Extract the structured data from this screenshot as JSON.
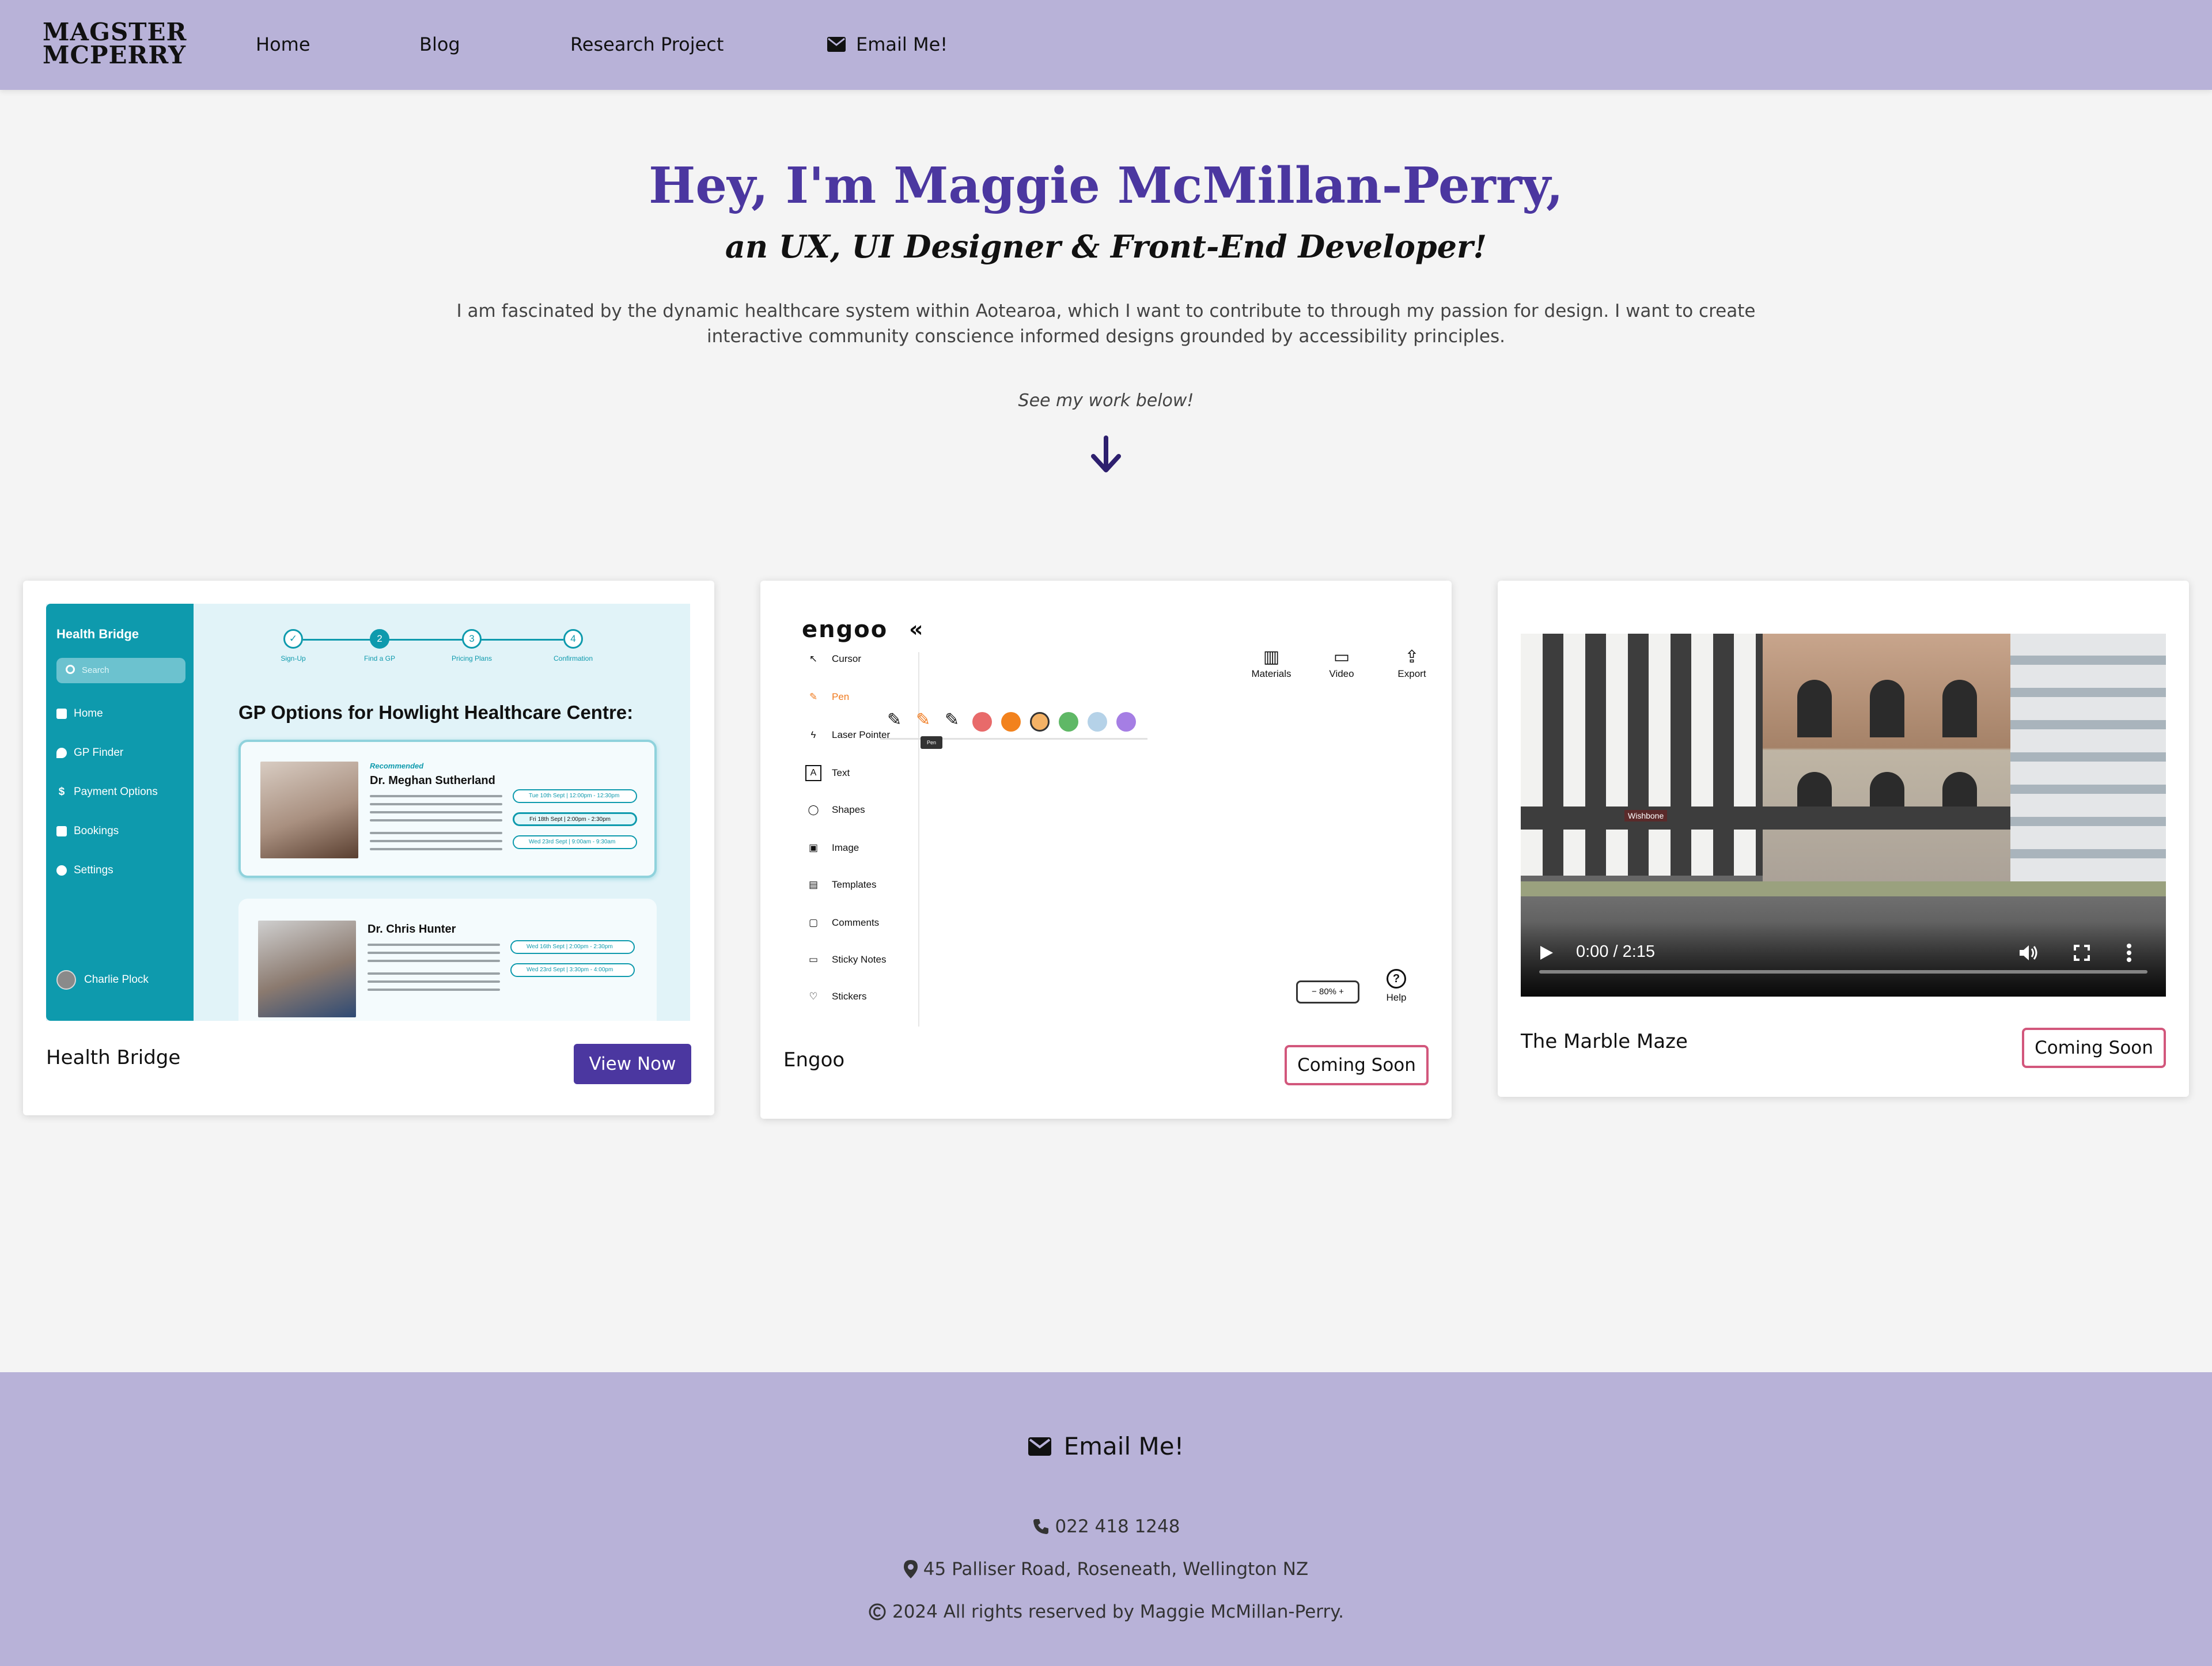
{
  "nav": {
    "logo": "MAGSTER MCPERRY",
    "links": [
      "Home",
      "Blog",
      "Research Project"
    ],
    "email_label": "Email Me!"
  },
  "hero": {
    "title": "Hey, I'm Maggie McMillan-Perry,",
    "subtitle": "an UX, UI Designer & Front-End Developer!",
    "description": "I am fascinated by the dynamic healthcare system within Aotearoa, which I want to contribute to through my passion for design. I want to create interactive community conscience informed designs grounded by accessibility principles.",
    "see_work": "See my work below!"
  },
  "projects": [
    {
      "title": "Health Bridge",
      "button": "View Now",
      "preview": {
        "brand": "Health Bridge",
        "search_placeholder": "Search",
        "menu": [
          "Home",
          "GP Finder",
          "Payment Options",
          "Bookings",
          "Settings"
        ],
        "user": "Charlie Plock",
        "steps": [
          {
            "num": "✓",
            "label": "Sign-Up"
          },
          {
            "num": "2",
            "label": "Find a GP"
          },
          {
            "num": "3",
            "label": "Pricing Plans"
          },
          {
            "num": "4",
            "label": "Confirmation"
          }
        ],
        "heading": "GP Options for Howlight Healthcare Centre:",
        "doctors": [
          {
            "tag": "Recommended",
            "name": "Dr. Meghan Sutherland",
            "slots": [
              "Tue 10th Sept | 12:00pm - 12:30pm",
              "Fri 18th Sept | 2:00pm - 2:30pm",
              "Wed 23rd Sept | 9:00am - 9:30am"
            ]
          },
          {
            "tag": "",
            "name": "Dr. Chris Hunter",
            "slots": [
              "Wed 16th Sept | 2:00pm - 2:30pm",
              "Wed 23rd Sept | 3:30pm - 4:00pm"
            ]
          }
        ]
      }
    },
    {
      "title": "Engoo",
      "button": "Coming Soon",
      "preview": {
        "logo": "engoo",
        "collapse": "«",
        "tools": [
          "Cursor",
          "Pen",
          "Laser Pointer",
          "Text",
          "Shapes",
          "Image",
          "Templates",
          "Comments",
          "Sticky Notes",
          "Stickers"
        ],
        "active_tool": "Pen",
        "tooltip": "Pen",
        "swatches": [
          "#e86a6a",
          "#f2821d",
          "#f4b266",
          "#5fb866",
          "#b5d2e8",
          "#a57ee4"
        ],
        "top_actions": [
          "Materials",
          "Video",
          "Export"
        ],
        "zoom": "−  80%  +",
        "help": "Help"
      }
    },
    {
      "title": "The Marble Maze",
      "button": "Coming Soon",
      "video": {
        "time": "0:00 / 2:15",
        "sign": "Wishbone"
      }
    }
  ],
  "footer": {
    "email_label": "Email Me!",
    "phone": "022 418 1248",
    "address": "45 Palliser Road, Roseneath, Wellington NZ",
    "copyright": "2024 All rights reserved by Maggie McMillan-Perry."
  },
  "colors": {
    "nav_bg": "#b8b2d8",
    "accent": "#4b37a0",
    "outline_button": "#d2577c",
    "page_bg": "#f4f4f4"
  }
}
